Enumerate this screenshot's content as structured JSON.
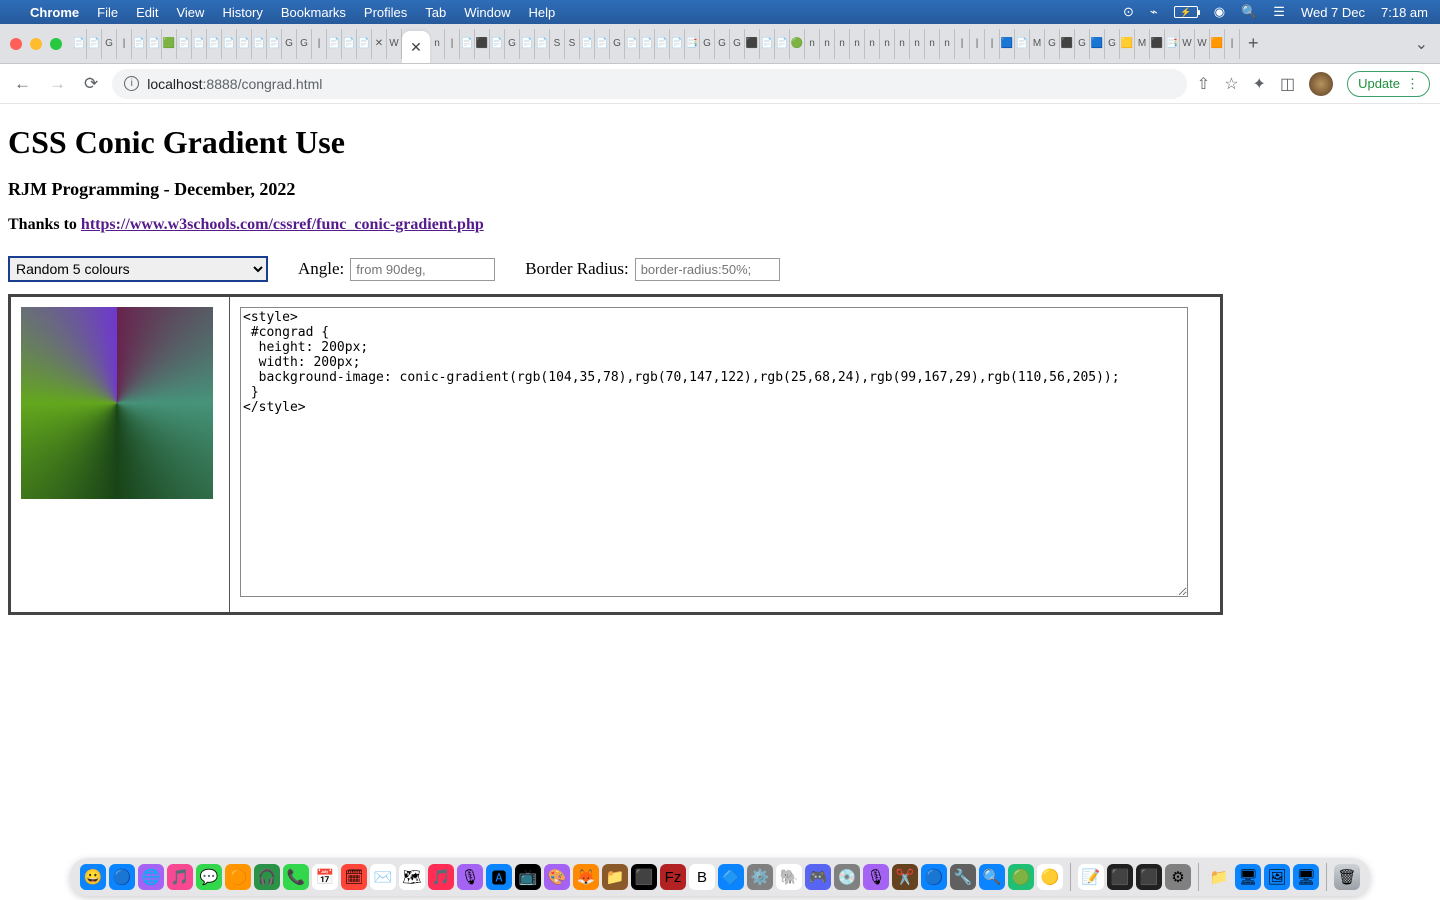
{
  "menubar": {
    "app_name": "Chrome",
    "menus": [
      "File",
      "Edit",
      "View",
      "History",
      "Bookmarks",
      "Profiles",
      "Tab",
      "Window",
      "Help"
    ],
    "date": "Wed 7 Dec",
    "time": "7:18 am"
  },
  "browser": {
    "url_prefix": "localhost",
    "url_port": ":8888",
    "url_path": "/congrad.html",
    "update_label": "Update"
  },
  "page": {
    "title": "CSS Conic Gradient Use",
    "subtitle": "RJM Programming - December, 2022",
    "thanks_prefix": "Thanks to ",
    "thanks_link": "https://www.w3schools.com/cssref/func_conic-gradient.php",
    "controls": {
      "dropdown_selected": "Random 5 colours",
      "angle_label": "Angle:",
      "angle_placeholder": "from 90deg,",
      "border_label": "Border Radius:",
      "border_placeholder": "border-radius:50%;"
    },
    "code": "<style>\n #congrad {\n  height: 200px;\n  width: 200px;\n  background-image: conic-gradient(rgb(104,35,78),rgb(70,147,122),rgb(25,68,24),rgb(99,167,29),rgb(110,56,205));\n }\n</style>",
    "gradient_colors": [
      "rgb(104,35,78)",
      "rgb(70,147,122)",
      "rgb(25,68,24)",
      "rgb(99,167,29)",
      "rgb(110,56,205)"
    ]
  },
  "tab_favs": [
    "📄",
    "📄",
    "G",
    "|",
    "📄",
    "📄",
    "🟩",
    "📄",
    "📄",
    "📄",
    "📄",
    "📄",
    "📄",
    "📄",
    "G",
    "G",
    "|",
    "📄",
    "📄",
    "📄",
    "✕",
    "W",
    "📄",
    "n",
    "|",
    "📄",
    "⬛",
    "📄",
    "G",
    "📄",
    "📄",
    "S",
    "S",
    "📄",
    "📄",
    "G",
    "📄",
    "📄",
    "📄",
    "📄",
    "📑",
    "G",
    "G",
    "G",
    "⬛",
    "📄",
    "📄",
    "🟢",
    "n",
    "n",
    "n",
    "n",
    "n",
    "n",
    "n",
    "n",
    "n",
    "n",
    "|",
    "|",
    "|",
    "🟦",
    "📄",
    "M",
    "G",
    "⬛",
    "G",
    "🟦",
    "G",
    "🟨",
    "M",
    "⬛",
    "📑",
    "W",
    "W",
    "🟧",
    "|"
  ],
  "dock_apps": [
    {
      "c": "#0a84ff",
      "e": "😀"
    },
    {
      "c": "#0a84ff",
      "e": "🔵"
    },
    {
      "c": "#a463f2",
      "e": "🌐"
    },
    {
      "c": "#f94892",
      "e": "🎵"
    },
    {
      "c": "#32d74b",
      "e": "💬"
    },
    {
      "c": "#ff9500",
      "e": "🟠"
    },
    {
      "c": "#2b9348",
      "e": "🎧"
    },
    {
      "c": "#32d74b",
      "e": "📞"
    },
    {
      "c": "#ffffff",
      "e": "📅"
    },
    {
      "c": "#ff453a",
      "e": "🗓"
    },
    {
      "c": "#ffffff",
      "e": "✉️"
    },
    {
      "c": "#ffffff",
      "e": "🗺"
    },
    {
      "c": "#ff2d55",
      "e": "🎵"
    },
    {
      "c": "#a463f2",
      "e": "🎙"
    },
    {
      "c": "#0a84ff",
      "e": "🅰"
    },
    {
      "c": "#000000",
      "e": "📺"
    },
    {
      "c": "#a463f2",
      "e": "🎨"
    },
    {
      "c": "#ff8a00",
      "e": "🦊"
    },
    {
      "c": "#8b5a2b",
      "e": "📁"
    },
    {
      "c": "#000000",
      "e": "⬛"
    },
    {
      "c": "#b22222",
      "e": "Fz"
    },
    {
      "c": "#ffffff",
      "e": "B"
    },
    {
      "c": "#0a84ff",
      "e": "🔷"
    },
    {
      "c": "#808080",
      "e": "⚙️"
    },
    {
      "c": "#ffffff",
      "e": "🐘"
    },
    {
      "c": "#5865f2",
      "e": "🎮"
    },
    {
      "c": "#808080",
      "e": "💿"
    },
    {
      "c": "#a463f2",
      "e": "🎙"
    },
    {
      "c": "#654321",
      "e": "✂️"
    },
    {
      "c": "#0a84ff",
      "e": "🔵"
    },
    {
      "c": "#606060",
      "e": "🔧"
    },
    {
      "c": "#0a84ff",
      "e": "🔍"
    },
    {
      "c": "#1fbf75",
      "e": "🟢"
    },
    {
      "c": "#ffffff",
      "e": "🟡"
    }
  ],
  "dock_apps2": [
    {
      "c": "#ffffff",
      "e": "📝"
    },
    {
      "c": "#202020",
      "e": "⬛"
    },
    {
      "c": "#202020",
      "e": "⬛"
    },
    {
      "c": "#808080",
      "e": "⚙"
    }
  ],
  "dock_apps3": [
    {
      "c": "#e6e6e6",
      "e": "📁"
    },
    {
      "c": "#0a84ff",
      "e": "🖥"
    },
    {
      "c": "#0a84ff",
      "e": "🖼"
    },
    {
      "c": "#0a84ff",
      "e": "🖥"
    }
  ]
}
